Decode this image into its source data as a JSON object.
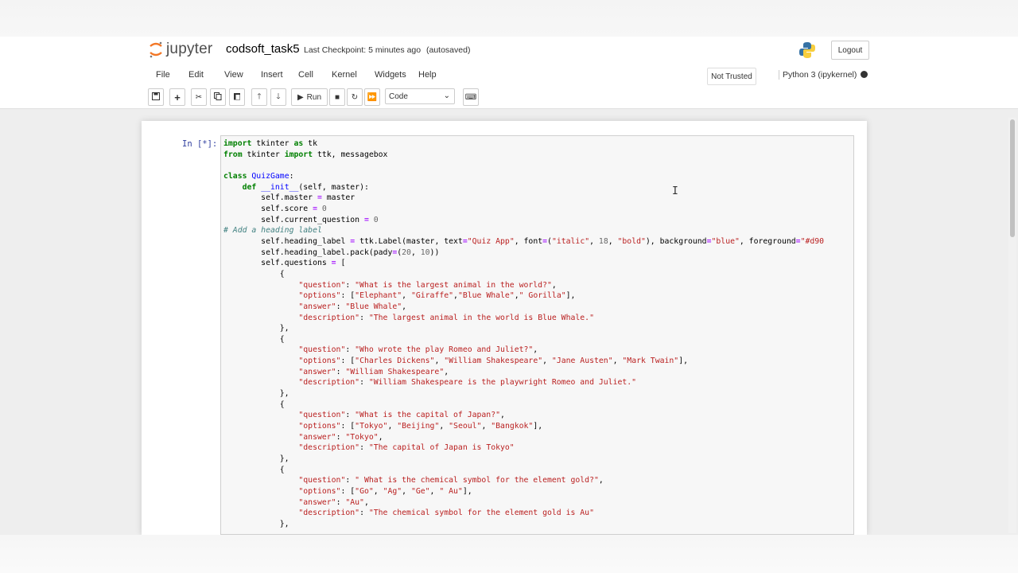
{
  "header": {
    "logo_text": "jupyter",
    "notebook_title": "codsoft_task5",
    "checkpoint": "Last Checkpoint: 5 minutes ago",
    "autosave": "(autosaved)",
    "logout_label": "Logout",
    "trust_status": "Not Trusted",
    "kernel": "Python 3 (ipykernel)"
  },
  "menu": [
    "File",
    "Edit",
    "View",
    "Insert",
    "Cell",
    "Kernel",
    "Widgets",
    "Help"
  ],
  "toolbar": {
    "run_label": "Run",
    "cell_type": "Code"
  },
  "cell": {
    "prompt": "In [*]:",
    "code_lines": [
      "import tkinter as tk",
      "from tkinter import ttk, messagebox",
      "",
      "class QuizGame:",
      "    def __init__(self, master):",
      "        self.master = master",
      "        self.score = 0",
      "        self.current_question = 0",
      "# Add a heading label",
      "        self.heading_label = ttk.Label(master, text=\"Quiz App\", font=(\"italic\", 18, \"bold\"), background=\"blue\", foreground=\"#d90",
      "        self.heading_label.pack(pady=(20, 10))",
      "        self.questions = [",
      "            {",
      "                \"question\": \"What is the largest animal in the world?\",",
      "                \"options\": [\"Elephant\", \"Giraffe\",\"Blue Whale\",\" Gorilla\"],",
      "                \"answer\": \"Blue Whale\",",
      "                \"description\": \"The largest animal in the world is Blue Whale.\"",
      "            },",
      "            {",
      "                \"question\": \"Who wrote the play Romeo and Juliet?\",",
      "                \"options\": [\"Charles Dickens\", \"William Shakespeare\", \"Jane Austen\", \"Mark Twain\"],",
      "                \"answer\": \"William Shakespeare\",",
      "                \"description\": \"William Shakespeare is the playwright Romeo and Juliet.\"",
      "            },",
      "            {",
      "                \"question\": \"What is the capital of Japan?\",",
      "                \"options\": [\"Tokyo\", \"Beijing\", \"Seoul\", \"Bangkok\"],",
      "                \"answer\": \"Tokyo\",",
      "                \"description\": \"The capital of Japan is Tokyo\"",
      "            },",
      "            {",
      "                \"question\": \" What is the chemical symbol for the element gold?\",",
      "                \"options\": [\"Go\", \"Ag\", \"Ge\", \" Au\"],",
      "                \"answer\": \"Au\",",
      "                \"description\": \"The chemical symbol for the element gold is Au\"",
      "            },"
    ]
  },
  "icons": {
    "save": "save-icon",
    "add": "plus-icon",
    "cut": "scissors-icon",
    "copy": "copy-icon",
    "paste": "paste-icon",
    "up": "arrow-up-icon",
    "down": "arrow-down-icon",
    "run": "play-icon",
    "stop": "stop-icon",
    "restart": "restart-icon",
    "fast_forward": "fast-forward-icon",
    "keyboard": "keyboard-icon"
  },
  "colors": {
    "prompt": "#303f9f",
    "keyword": "#008000",
    "string": "#ba2121",
    "comment": "#408080"
  }
}
